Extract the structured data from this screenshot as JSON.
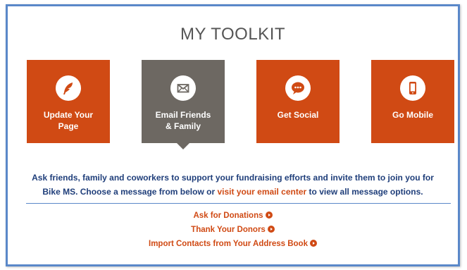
{
  "toolkit": {
    "title": "MY TOOLKIT",
    "tiles": [
      {
        "label_line1": "Update Your",
        "label_line2": "Page",
        "icon": "feather-icon"
      },
      {
        "label_line1": "Email Friends",
        "label_line2": "& Family",
        "icon": "envelope-icon",
        "active": true
      },
      {
        "label_line1": "Get Social",
        "label_line2": "",
        "icon": "chat-bubble-icon"
      },
      {
        "label_line1": "Go Mobile",
        "label_line2": "",
        "icon": "mobile-phone-icon"
      }
    ],
    "description": {
      "text_part1": "Ask friends, family and coworkers to support your fundraising efforts and invite them to join you for Bike MS. Choose a message from below or ",
      "link_text": "visit your email center",
      "text_part2": " to view all message options."
    },
    "links": [
      {
        "label": "Ask for Donations"
      },
      {
        "label": "Thank Your Donors"
      },
      {
        "label": "Import Contacts from Your Address Book"
      }
    ]
  },
  "colors": {
    "accent_orange": "#d04a14",
    "active_tile": "#6d6862",
    "text_blue": "#1f3e7a",
    "border_blue": "#5a88c9"
  }
}
